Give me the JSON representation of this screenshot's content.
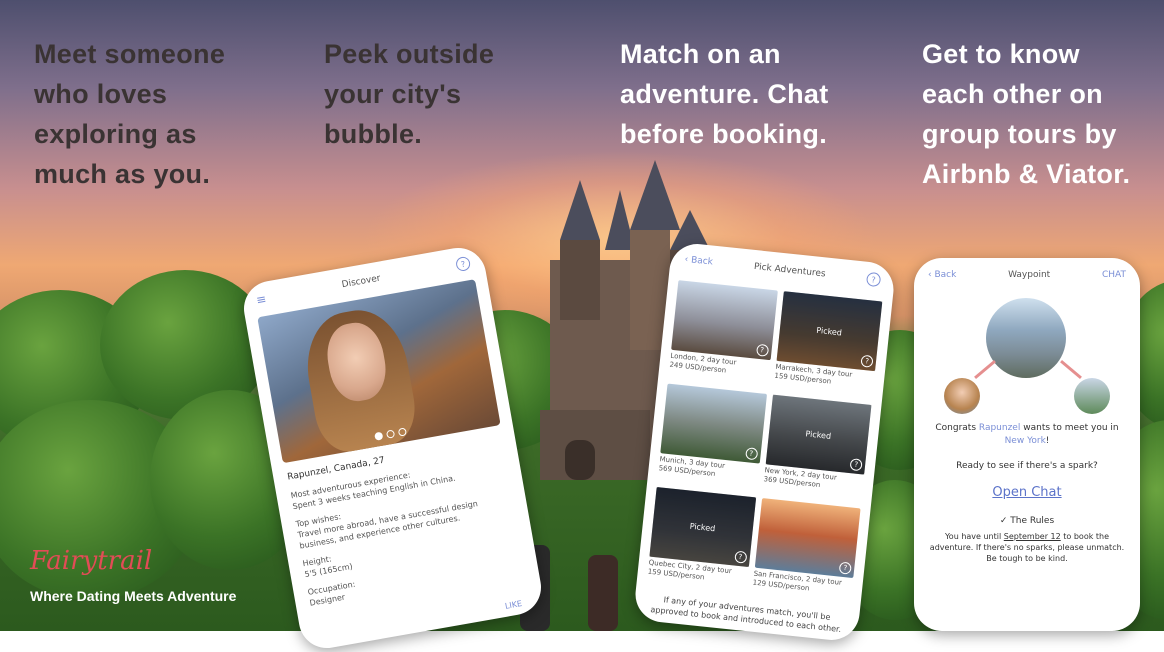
{
  "headlines": [
    "Meet someone who loves exploring as much as you.",
    "Peek outside your city's bubble.",
    "Match on an adventure. Chat before booking.",
    "Get to know each other on group tours by Airbnb & Viator."
  ],
  "brand": {
    "logo": "Fairytrail",
    "tagline": "Where Dating Meets Adventure"
  },
  "discover": {
    "title": "Discover",
    "name": "Rapunzel, Canada, 27",
    "experience_label": "Most adventurous experience:",
    "experience": "Spent 3 weeks teaching English in China.",
    "wishes_label": "Top wishes:",
    "wishes": "Travel more abroad, have a successful design business, and experience other cultures.",
    "height_label": "Height:",
    "height": "5'5 (165cm)",
    "occupation_label": "Occupation:",
    "occupation": "Designer",
    "like": "LIKE"
  },
  "adventures": {
    "back": "Back",
    "title": "Pick Adventures",
    "picked_label": "Picked",
    "tiles": [
      {
        "line1": "London, 2 day tour",
        "line2": "249 USD/person",
        "picked": false
      },
      {
        "line1": "Marrakech, 3 day tour",
        "line2": "159 USD/person",
        "picked": true
      },
      {
        "line1": "Munich, 3 day tour",
        "line2": "569 USD/person",
        "picked": false
      },
      {
        "line1": "New York, 2 day tour",
        "line2": "369 USD/person",
        "picked": true
      },
      {
        "line1": "Quebec City, 2 day tour",
        "line2": "159 USD/person",
        "picked": true
      },
      {
        "line1": "San Francisco, 2 day tour",
        "line2": "129 USD/person",
        "picked": false
      }
    ],
    "footer": "If any of your adventures match, you'll be approved to book and introduced to each other."
  },
  "waypoint": {
    "back": "Back",
    "title": "Waypoint",
    "chat": "CHAT",
    "congrats_pre": "Congrats",
    "congrats_name": "Rapunzel",
    "congrats_mid": "wants to meet you in",
    "congrats_city": "New York",
    "spark": "Ready to see if there's a spark?",
    "open_chat": "Open Chat",
    "rules_title": "The Rules",
    "rules_pre": "You have until",
    "rules_date": "September 12",
    "rules_post": "to book the adventure. If there's no sparks, please unmatch. Be tough to be kind."
  },
  "colors": {
    "accent": "#7b8fd6",
    "brand": "#e24c56"
  }
}
